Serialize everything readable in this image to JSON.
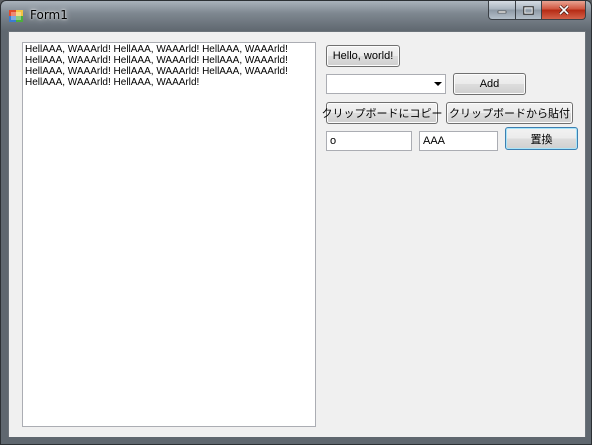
{
  "window": {
    "title": "Form1"
  },
  "caption_buttons": {
    "minimize": "minimize-icon",
    "maximize": "maximize-icon",
    "close": "close-icon"
  },
  "textbox": {
    "value": "HellAAA, WAAArld! HellAAA, WAAArld! HellAAA, WAAArld! HellAAA, WAAArld! HellAAA, WAAArld! HellAAA, WAAArld! HellAAA, WAAArld! HellAAA, WAAArld! HellAAA, WAAArld! HellAAA, WAAArld! HellAAA, WAAArld!"
  },
  "buttons": {
    "hello": "Hello, world!",
    "add": "Add",
    "copy": "クリップボードにコピー",
    "paste": "クリップボードから貼付",
    "replace": "置換"
  },
  "combo": {
    "value": ""
  },
  "replace_fields": {
    "find": "o",
    "replace_with": "AAA"
  }
}
